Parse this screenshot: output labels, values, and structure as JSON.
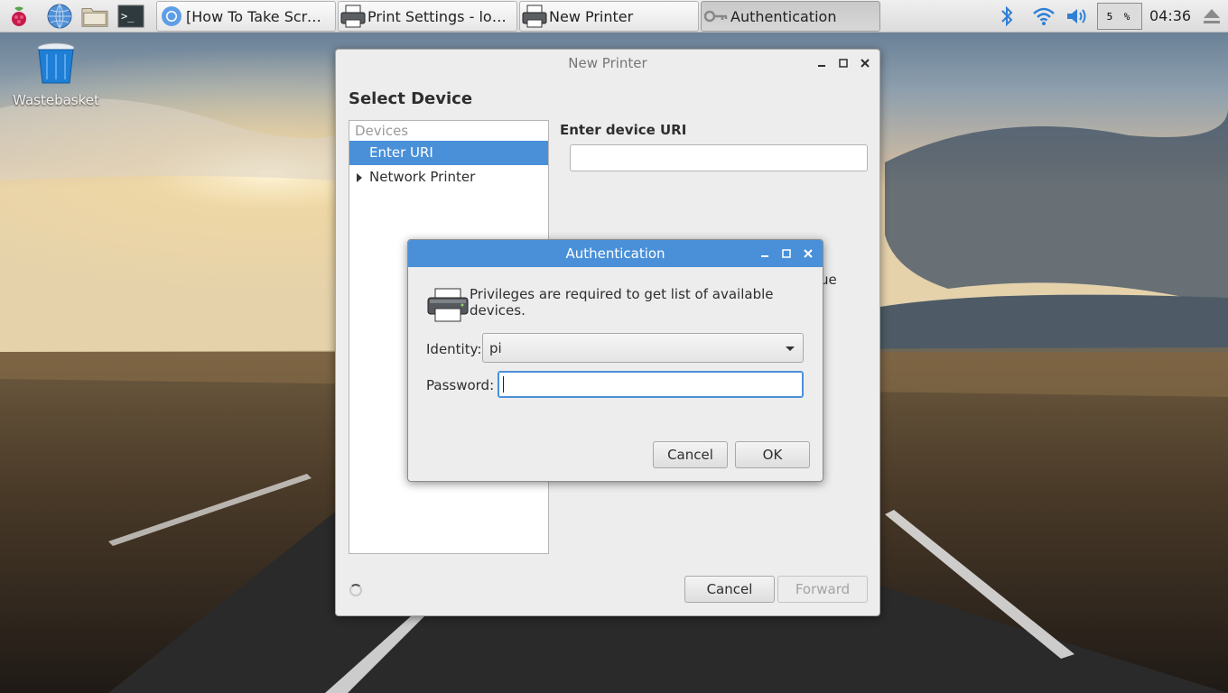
{
  "panel": {
    "launchers": [
      {
        "name": "raspberry-menu-icon"
      },
      {
        "name": "web-browser-icon"
      },
      {
        "name": "file-manager-icon"
      },
      {
        "name": "terminal-icon"
      }
    ],
    "tasks": [
      {
        "label": "[How To Take Screen...",
        "icon": "chromium-icon",
        "active": false
      },
      {
        "label": "Print Settings - localh...",
        "icon": "printer-icon",
        "active": false
      },
      {
        "label": "New Printer",
        "icon": "printer-icon",
        "active": false
      },
      {
        "label": "Authentication",
        "icon": "key-icon",
        "active": true
      }
    ],
    "tray": {
      "cpu_text": "5 %",
      "clock": "04:36"
    }
  },
  "desktop": {
    "wastebasket_label": "Wastebasket"
  },
  "new_printer": {
    "title": "New Printer",
    "heading": "Select Device",
    "device_list": {
      "header": "Devices",
      "items": [
        {
          "label": "Enter URI",
          "selected": true,
          "expandable": false
        },
        {
          "label": "Network Printer",
          "selected": false,
          "expandable": true
        }
      ]
    },
    "uri_label": "Enter device URI",
    "uri_value": "",
    "partial_text": "ue",
    "cancel_label": "Cancel",
    "forward_label": "Forward"
  },
  "auth": {
    "title": "Authentication",
    "message": "Privileges are required to get list of available devices.",
    "identity_label": "Identity:",
    "identity_value": "pi",
    "password_label": "Password:",
    "password_value": "",
    "cancel_label": "Cancel",
    "ok_label": "OK"
  },
  "colors": {
    "accent": "#4a90d9",
    "panel_bg": "#e6e6e6",
    "window_bg": "#ededed"
  }
}
